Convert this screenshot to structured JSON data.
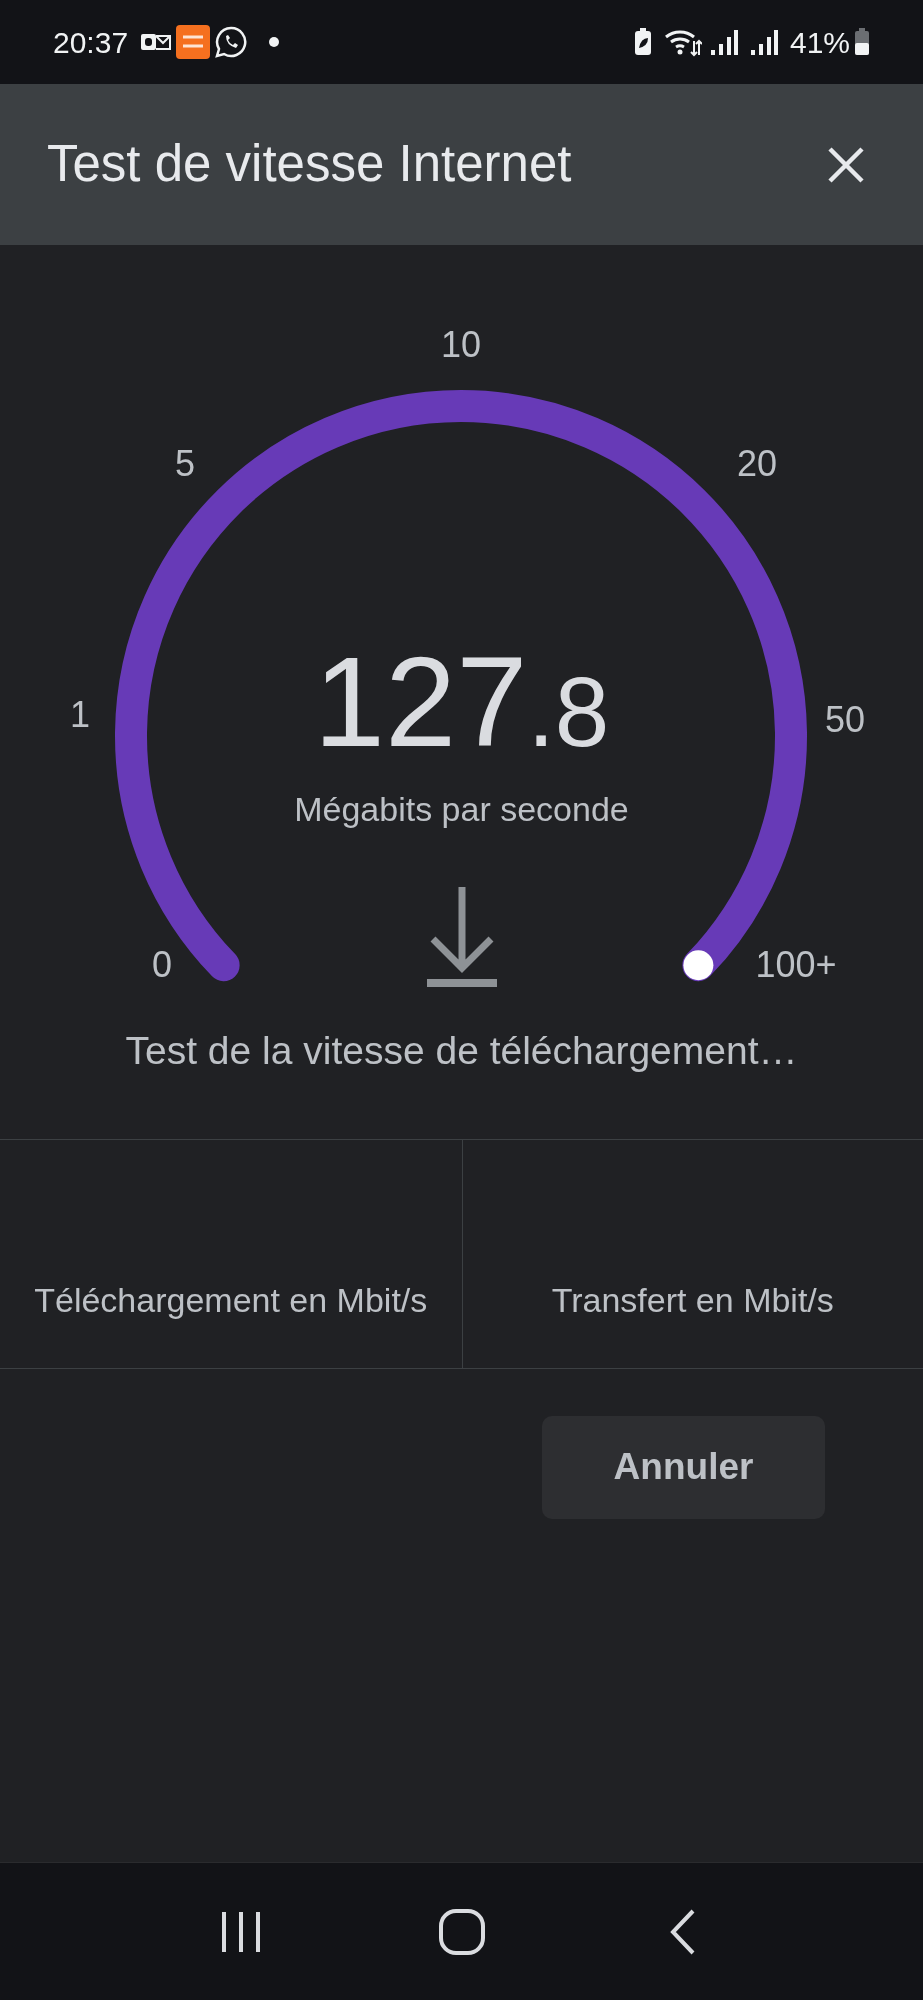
{
  "status_bar": {
    "time": "20:37",
    "battery": "41%"
  },
  "header": {
    "title": "Test de vitesse Internet"
  },
  "gauge": {
    "ticks": [
      "0",
      "1",
      "5",
      "10",
      "20",
      "50",
      "100+"
    ],
    "value": "127",
    "decimal": ".8",
    "unit": "Mégabits par seconde"
  },
  "status_text": "Test de la vitesse de téléchargement…",
  "stats": [
    {
      "label": "Téléchargement en Mbit/s"
    },
    {
      "label": "Transfert en Mbit/s"
    }
  ],
  "cancel_button": "Annuler"
}
